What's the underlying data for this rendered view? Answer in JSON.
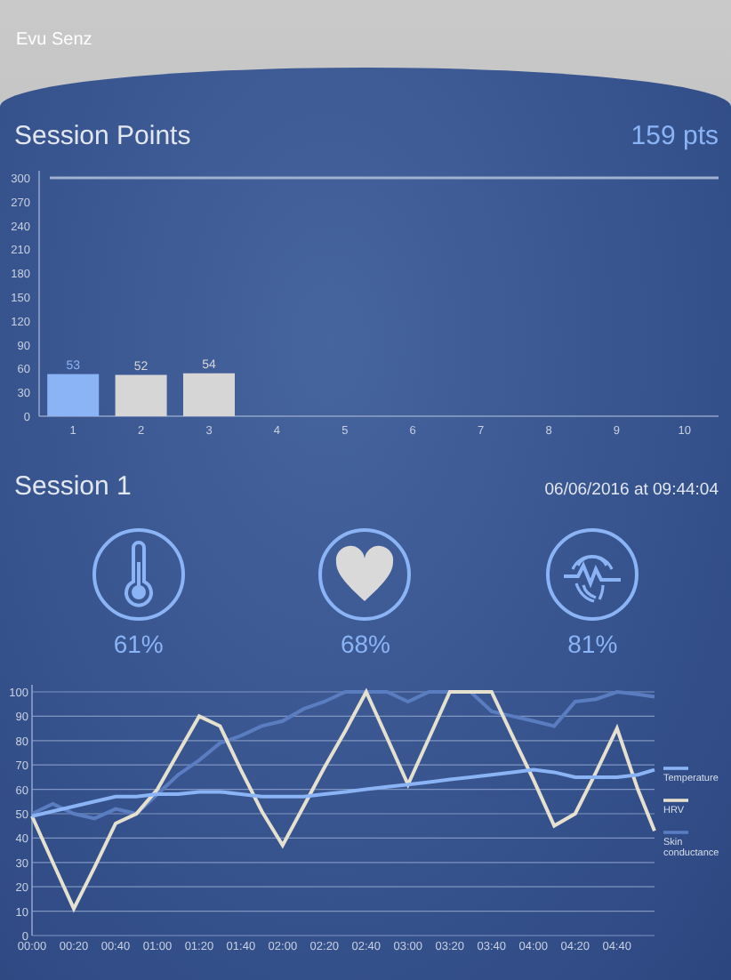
{
  "app_title": "Evu Senz",
  "session_points": {
    "title": "Session Points",
    "total": "159 pts",
    "chart_data": {
      "type": "bar",
      "categories": [
        "1",
        "2",
        "3",
        "4",
        "5",
        "6",
        "7",
        "8",
        "9",
        "10"
      ],
      "stacked": true,
      "data_labels": true,
      "ylim": [
        0,
        300
      ],
      "yticks": [
        0,
        30,
        60,
        90,
        120,
        150,
        180,
        210,
        240,
        270,
        300
      ],
      "series": [
        {
          "color": "#8ab4f5",
          "values": [
            53,
            null,
            null,
            null,
            null,
            null,
            null,
            null,
            null,
            null
          ]
        },
        {
          "color": "#d6d6d6",
          "values": [
            null,
            52,
            54,
            null,
            null,
            null,
            null,
            null,
            null,
            null
          ]
        }
      ]
    }
  },
  "session": {
    "title": "Session 1",
    "datetime": "06/06/2016 at 09:44:04",
    "metrics": [
      {
        "kind": "temperature",
        "value": "61%"
      },
      {
        "kind": "heart",
        "value": "68%"
      },
      {
        "kind": "skin",
        "value": "81%"
      }
    ],
    "chart_data": {
      "type": "line",
      "grid": true,
      "legend": true,
      "x": [
        0,
        10,
        20,
        30,
        40,
        50,
        60,
        70,
        80,
        90,
        100,
        110,
        120,
        130,
        140,
        150,
        160,
        170,
        180,
        190,
        200,
        210,
        220,
        230,
        240,
        250,
        260,
        270,
        280,
        290,
        298
      ],
      "xlim": [
        0,
        298
      ],
      "ylim": [
        0,
        100
      ],
      "yticks": [
        0,
        10,
        20,
        30,
        40,
        50,
        60,
        70,
        80,
        90,
        100
      ],
      "xticks": [
        {
          "value": 0,
          "label": "00:00"
        },
        {
          "value": 20,
          "label": "00:20"
        },
        {
          "value": 40,
          "label": "00:40"
        },
        {
          "value": 60,
          "label": "01:00"
        },
        {
          "value": 80,
          "label": "01:20"
        },
        {
          "value": 100,
          "label": "01:40"
        },
        {
          "value": 120,
          "label": "02:00"
        },
        {
          "value": 140,
          "label": "02:20"
        },
        {
          "value": 160,
          "label": "02:40"
        },
        {
          "value": 180,
          "label": "03:00"
        },
        {
          "value": 200,
          "label": "03:20"
        },
        {
          "value": 220,
          "label": "03:40"
        },
        {
          "value": 240,
          "label": "04:00"
        },
        {
          "value": 260,
          "label": "04:20"
        },
        {
          "value": 280,
          "label": "04:40"
        }
      ],
      "series": [
        {
          "name": "Temperature",
          "color": "#8ab4f5",
          "values": [
            49,
            51,
            53,
            55,
            57,
            57,
            58,
            58,
            59,
            59,
            58,
            57,
            57,
            57,
            58,
            59,
            60,
            61,
            62,
            63,
            64,
            65,
            66,
            67,
            68,
            67,
            65,
            65,
            65,
            66,
            68
          ]
        },
        {
          "name": "HRV",
          "color": "#e6e0cf",
          "values": [
            49,
            30,
            11,
            28,
            46,
            50,
            60,
            75,
            90,
            86,
            68,
            51,
            37,
            53,
            69,
            84,
            100,
            81,
            62,
            81,
            100,
            100,
            100,
            82,
            64,
            45,
            50,
            67,
            85,
            60,
            43
          ]
        },
        {
          "name": "Skin conductance",
          "color": "#5a7cc0",
          "values": [
            50,
            54,
            50,
            48,
            52,
            50,
            58,
            66,
            72,
            79,
            82,
            86,
            88,
            93,
            96,
            100,
            100,
            100,
            96,
            100,
            100,
            100,
            92,
            90,
            88,
            86,
            96,
            97,
            100,
            99,
            98
          ]
        }
      ]
    }
  }
}
